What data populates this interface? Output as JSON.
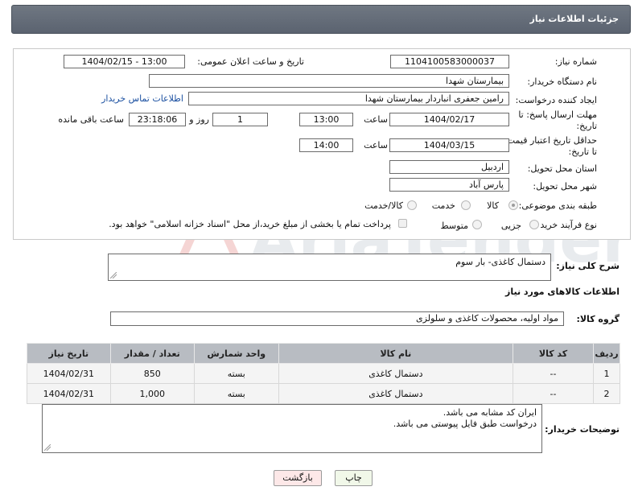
{
  "header": {
    "title": "جزئیات اطلاعات نیاز"
  },
  "form": {
    "need_number_label": "شماره نیاز:",
    "need_number": "1104100583000037",
    "announce_label": "تاریخ و ساعت اعلان عمومی:",
    "announce_value": "1404/02/15 - 13:00",
    "buyer_org_label": "نام دستگاه خریدار:",
    "buyer_org": "بیمارستان شهدا",
    "creator_label": "ایجاد کننده درخواست:",
    "creator": "رامین جعفری انباردار بیمارستان شهدا",
    "contact_link": "اطلاعات تماس خریدار",
    "reply_deadline_label_1": "مهلت ارسال پاسخ: تا",
    "reply_deadline_label_2": "تاریخ:",
    "reply_date": "1404/02/17",
    "time_label": "ساعت",
    "reply_time": "13:00",
    "days_value": "1",
    "days_label": "روز و",
    "remaining_value": "23:18:06",
    "remaining_label": "ساعت باقی مانده",
    "price_validity_label_1": "حداقل تاریخ اعتبار قیمت:",
    "price_validity_label_2": "تا تاریخ:",
    "price_date": "1404/03/15",
    "price_time": "14:00",
    "province_label": "استان محل تحویل:",
    "province": "اردبیل",
    "city_label": "شهر محل تحویل:",
    "city": "پارس آباد",
    "category_label": "طبقه بندی موضوعی:",
    "category_options": [
      "کالا",
      "خدمت",
      "کالا/خدمت"
    ],
    "category_selected": "کالا",
    "process_label": "نوع فرآیند خرید :",
    "process_options": [
      "جزیی",
      "متوسط"
    ],
    "payment_note": "پرداخت تمام یا بخشی از مبلغ خرید،از محل \"اسناد خزانه اسلامی\" خواهد بود."
  },
  "description": {
    "label": "شرح کلی نیاز:",
    "text": "دستمال کاغذی- بار سوم"
  },
  "goods_section": {
    "title": "اطلاعات کالاهای مورد نیاز",
    "group_label": "گروه کالا:",
    "group_value": "مواد اولیه، محصولات کاغذی و سلولزی"
  },
  "table": {
    "headers": [
      "ردیف",
      "کد کالا",
      "نام کالا",
      "واحد شمارش",
      "تعداد / مقدار",
      "تاریخ نیاز"
    ],
    "rows": [
      [
        "1",
        "--",
        "دستمال کاغذی",
        "بسته",
        "850",
        "1404/02/31"
      ],
      [
        "2",
        "--",
        "دستمال کاغذی",
        "بسته",
        "1,000",
        "1404/02/31"
      ]
    ]
  },
  "buyer_notes": {
    "label": "توضیحات خریدار:",
    "line1": "ایران کد مشابه می باشد.",
    "line2": "درخواست طبق فایل پیوستی می باشد."
  },
  "buttons": {
    "print": "چاپ",
    "back": "بازگشت"
  },
  "watermark_text": "AriaTender.neT",
  "colors": {
    "header": "#616975",
    "table_header": "#b8bcc2",
    "back_button": "#fde8e8",
    "print_button": "#f1f8e9",
    "link": "#1a4fa0"
  }
}
